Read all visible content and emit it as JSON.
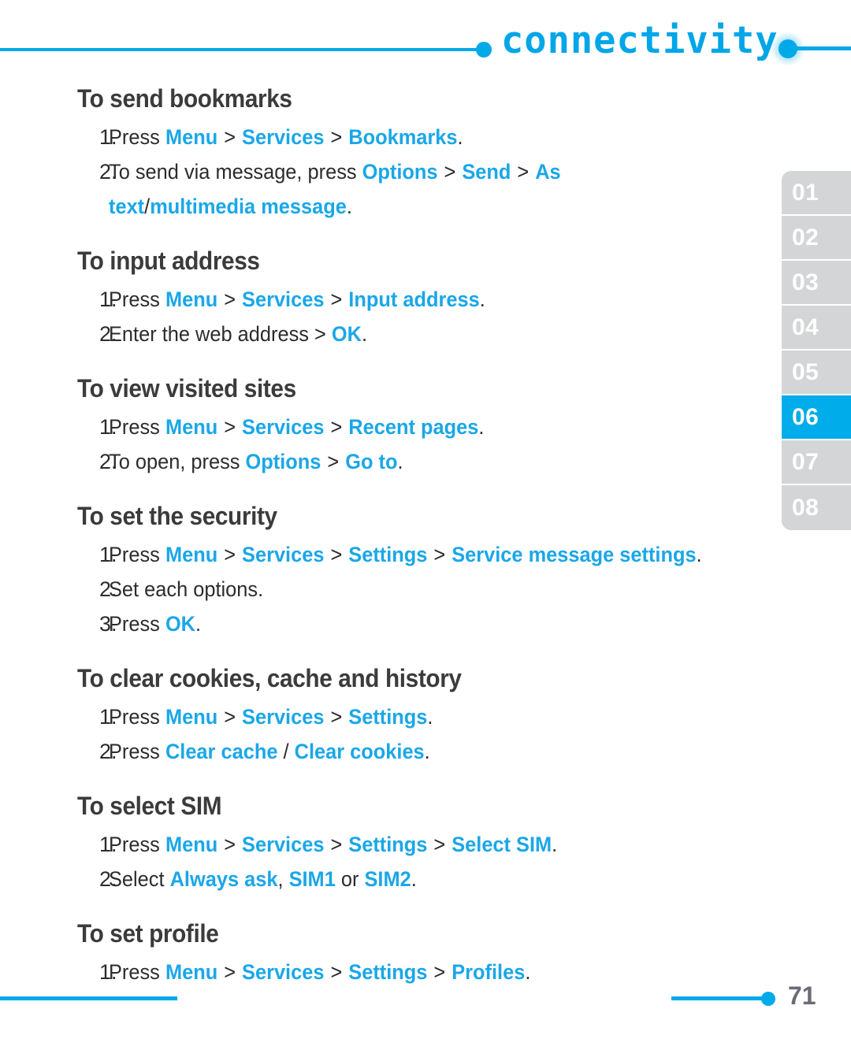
{
  "header": {
    "title": "connectivity",
    "left_dot_icon": "connector-dot-icon",
    "right_dot_icon": "connector-dot-glow-icon"
  },
  "side_tabs": {
    "items": [
      {
        "label": "01",
        "active": false
      },
      {
        "label": "02",
        "active": false
      },
      {
        "label": "03",
        "active": false
      },
      {
        "label": "04",
        "active": false
      },
      {
        "label": "05",
        "active": false
      },
      {
        "label": "06",
        "active": true
      },
      {
        "label": "07",
        "active": false
      },
      {
        "label": "08",
        "active": false
      }
    ],
    "active_label": "06"
  },
  "colors": {
    "accent_blue": "#00a9e8",
    "link_blue": "#1aa7e8",
    "heading_gray": "#3b3b3b",
    "tab_inactive": "#d3d5d7",
    "tab_active": "#00ace9",
    "page_number_gray": "#6b6b75"
  },
  "sections": [
    {
      "title": "To send bookmarks",
      "steps": [
        {
          "num": "1.",
          "parts": [
            {
              "t": "Press ",
              "s": "plain"
            },
            {
              "t": "Menu",
              "s": "hl"
            },
            {
              "t": " > ",
              "s": "sep"
            },
            {
              "t": "Services",
              "s": "hl"
            },
            {
              "t": " > ",
              "s": "sep"
            },
            {
              "t": "Bookmarks",
              "s": "hl"
            },
            {
              "t": ".",
              "s": "plain"
            }
          ]
        },
        {
          "num": "2.",
          "parts": [
            {
              "t": "To send via message, press ",
              "s": "plain"
            },
            {
              "t": "Options",
              "s": "hl"
            },
            {
              "t": " > ",
              "s": "sep"
            },
            {
              "t": "Send",
              "s": "hl"
            },
            {
              "t": " > ",
              "s": "sep"
            },
            {
              "t": "As text",
              "s": "hl"
            },
            {
              "t": "/",
              "s": "plain"
            },
            {
              "t": "multimedia message",
              "s": "hl"
            },
            {
              "t": ".",
              "s": "plain"
            }
          ]
        }
      ]
    },
    {
      "title": "To input address",
      "steps": [
        {
          "num": "1.",
          "parts": [
            {
              "t": "Press ",
              "s": "plain"
            },
            {
              "t": "Menu",
              "s": "hl"
            },
            {
              "t": " > ",
              "s": "sep"
            },
            {
              "t": "Services",
              "s": "hl"
            },
            {
              "t": " > ",
              "s": "sep"
            },
            {
              "t": "Input address",
              "s": "hl"
            },
            {
              "t": ".",
              "s": "plain"
            }
          ]
        },
        {
          "num": "2.",
          "parts": [
            {
              "t": "Enter the web address > ",
              "s": "plain"
            },
            {
              "t": "OK",
              "s": "hl"
            },
            {
              "t": ".",
              "s": "plain"
            }
          ]
        }
      ]
    },
    {
      "title": "To view visited sites",
      "steps": [
        {
          "num": "1.",
          "parts": [
            {
              "t": "Press ",
              "s": "plain"
            },
            {
              "t": "Menu",
              "s": "hl"
            },
            {
              "t": " > ",
              "s": "sep"
            },
            {
              "t": "Services",
              "s": "hl"
            },
            {
              "t": " > ",
              "s": "sep"
            },
            {
              "t": "Recent pages",
              "s": "hl"
            },
            {
              "t": ".",
              "s": "plain"
            }
          ]
        },
        {
          "num": "2.",
          "parts": [
            {
              "t": "To open, press ",
              "s": "plain"
            },
            {
              "t": "Options",
              "s": "hl"
            },
            {
              "t": " > ",
              "s": "sep"
            },
            {
              "t": "Go to",
              "s": "hl"
            },
            {
              "t": ".",
              "s": "plain"
            }
          ]
        }
      ]
    },
    {
      "title": "To set the security",
      "steps": [
        {
          "num": "1.",
          "parts": [
            {
              "t": "Press ",
              "s": "plain"
            },
            {
              "t": "Menu",
              "s": "hl"
            },
            {
              "t": " > ",
              "s": "sep"
            },
            {
              "t": "Services",
              "s": "hl"
            },
            {
              "t": " > ",
              "s": "sep"
            },
            {
              "t": "Settings",
              "s": "hl"
            },
            {
              "t": " > ",
              "s": "sep"
            },
            {
              "t": "Service message settings",
              "s": "hl"
            },
            {
              "t": ".",
              "s": "plain"
            }
          ]
        },
        {
          "num": "2.",
          "parts": [
            {
              "t": "Set each options.",
              "s": "plain"
            }
          ]
        },
        {
          "num": "3.",
          "parts": [
            {
              "t": "Press ",
              "s": "plain"
            },
            {
              "t": "OK",
              "s": "hl"
            },
            {
              "t": ".",
              "s": "plain"
            }
          ]
        }
      ]
    },
    {
      "title": "To clear cookies, cache and history",
      "steps": [
        {
          "num": "1.",
          "parts": [
            {
              "t": "Press ",
              "s": "plain"
            },
            {
              "t": "Menu",
              "s": "hl"
            },
            {
              "t": " > ",
              "s": "sep"
            },
            {
              "t": "Services",
              "s": "hl"
            },
            {
              "t": " > ",
              "s": "sep"
            },
            {
              "t": "Settings",
              "s": "hl"
            },
            {
              "t": ".",
              "s": "plain"
            }
          ]
        },
        {
          "num": "2.",
          "parts": [
            {
              "t": "Press ",
              "s": "plain"
            },
            {
              "t": "Clear cache",
              "s": "hl"
            },
            {
              "t": " / ",
              "s": "plain"
            },
            {
              "t": "Clear cookies",
              "s": "hl"
            },
            {
              "t": ".",
              "s": "plain"
            }
          ]
        }
      ]
    },
    {
      "title": "To select SIM",
      "steps": [
        {
          "num": "1.",
          "parts": [
            {
              "t": "Press ",
              "s": "plain"
            },
            {
              "t": "Menu",
              "s": "hl"
            },
            {
              "t": " > ",
              "s": "sep"
            },
            {
              "t": "Services",
              "s": "hl"
            },
            {
              "t": " > ",
              "s": "sep"
            },
            {
              "t": "Settings",
              "s": "hl"
            },
            {
              "t": " > ",
              "s": "sep"
            },
            {
              "t": "Select SIM",
              "s": "hl"
            },
            {
              "t": ".",
              "s": "plain"
            }
          ]
        },
        {
          "num": "2.",
          "parts": [
            {
              "t": "Select ",
              "s": "plain"
            },
            {
              "t": "Always ask",
              "s": "hl"
            },
            {
              "t": ", ",
              "s": "plain"
            },
            {
              "t": "SIM1",
              "s": "hl"
            },
            {
              "t": " or ",
              "s": "plain"
            },
            {
              "t": "SIM2",
              "s": "hl"
            },
            {
              "t": ".",
              "s": "plain"
            }
          ]
        }
      ]
    },
    {
      "title": "To set profile",
      "steps": [
        {
          "num": "1.",
          "parts": [
            {
              "t": "Press ",
              "s": "plain"
            },
            {
              "t": "Menu",
              "s": "hl"
            },
            {
              "t": " > ",
              "s": "sep"
            },
            {
              "t": "Services",
              "s": "hl"
            },
            {
              "t": " > ",
              "s": "sep"
            },
            {
              "t": "Settings",
              "s": "hl"
            },
            {
              "t": " > ",
              "s": "sep"
            },
            {
              "t": "Profiles",
              "s": "hl"
            },
            {
              "t": ".",
              "s": "plain"
            }
          ]
        }
      ]
    }
  ],
  "footer": {
    "page_number": "71",
    "dot_icon": "page-marker-dot-icon"
  }
}
